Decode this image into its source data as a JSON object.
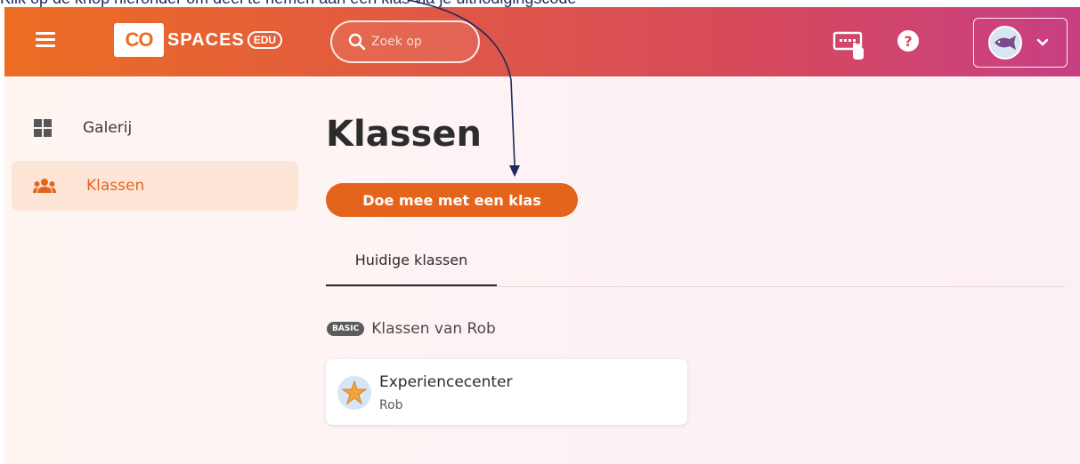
{
  "caption": {
    "text": "Klik op de knop hieronder om deel te nemen aan een klas via je uitnodigingscode"
  },
  "header": {
    "logo_co": "CO",
    "logo_spaces": "SPACES",
    "logo_edu": "EDU",
    "search_placeholder": "Zoek op",
    "help_label": "?",
    "icons": [
      "menu-icon",
      "search-icon",
      "keyboard-touch-icon",
      "help-icon",
      "chevron-down-icon"
    ]
  },
  "sidebar": {
    "items": [
      {
        "label": "Galerij",
        "icon": "grid-icon",
        "active": false
      },
      {
        "label": "Klassen",
        "icon": "people-icon",
        "active": true
      }
    ]
  },
  "main": {
    "title": "Klassen",
    "join_button": "Doe mee met een klas",
    "tabs": [
      {
        "label": "Huidige klassen",
        "active": true
      }
    ],
    "group": {
      "badge": "BASIC",
      "title": "Klassen van Rob"
    },
    "classes": [
      {
        "name": "Experiencecenter",
        "owner": "Rob"
      }
    ]
  },
  "colors": {
    "accent": "#e5641b",
    "header_gradient_start": "#ec6d22",
    "header_gradient_end": "#c83f84",
    "active_item_bg": "#fde6d8",
    "annotation_arrow": "#1f2a5a"
  }
}
